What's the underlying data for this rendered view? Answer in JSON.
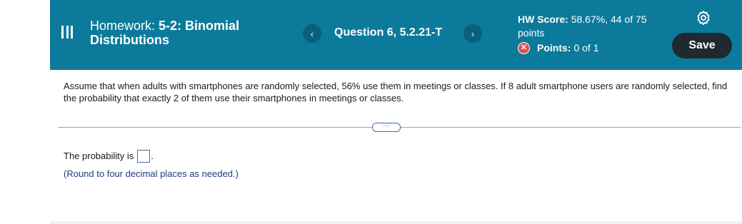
{
  "header": {
    "title_prefix": "Homework:",
    "title_name": "5-2: Binomial Distributions",
    "question_label": "Question 6, 5.2.21-T",
    "prev_glyph": "‹",
    "next_glyph": "›",
    "score_label": "HW Score:",
    "score_value": "58.67%, 44 of 75 points",
    "points_label": "Points:",
    "points_value": "0 of 1",
    "save_label": "Save",
    "icons": {
      "menu": "menu-icon",
      "settings": "gear-icon",
      "incorrect": "x-circle-icon"
    },
    "colors": {
      "header_bg": "#0c7a9b",
      "save_bg": "#1e2a30",
      "incorrect": "#d9534f"
    }
  },
  "question": {
    "text": "Assume that when adults with smartphones are randomly selected, 56% use them in meetings or classes. If 8 adult smartphone users are randomly selected, find the probability that exactly 2 of them use their smartphones in meetings or classes.",
    "expand_glyph": "···"
  },
  "answer": {
    "prompt": "The probability is",
    "period": ".",
    "note": "(Round to four decimal places as needed.)",
    "value": ""
  }
}
